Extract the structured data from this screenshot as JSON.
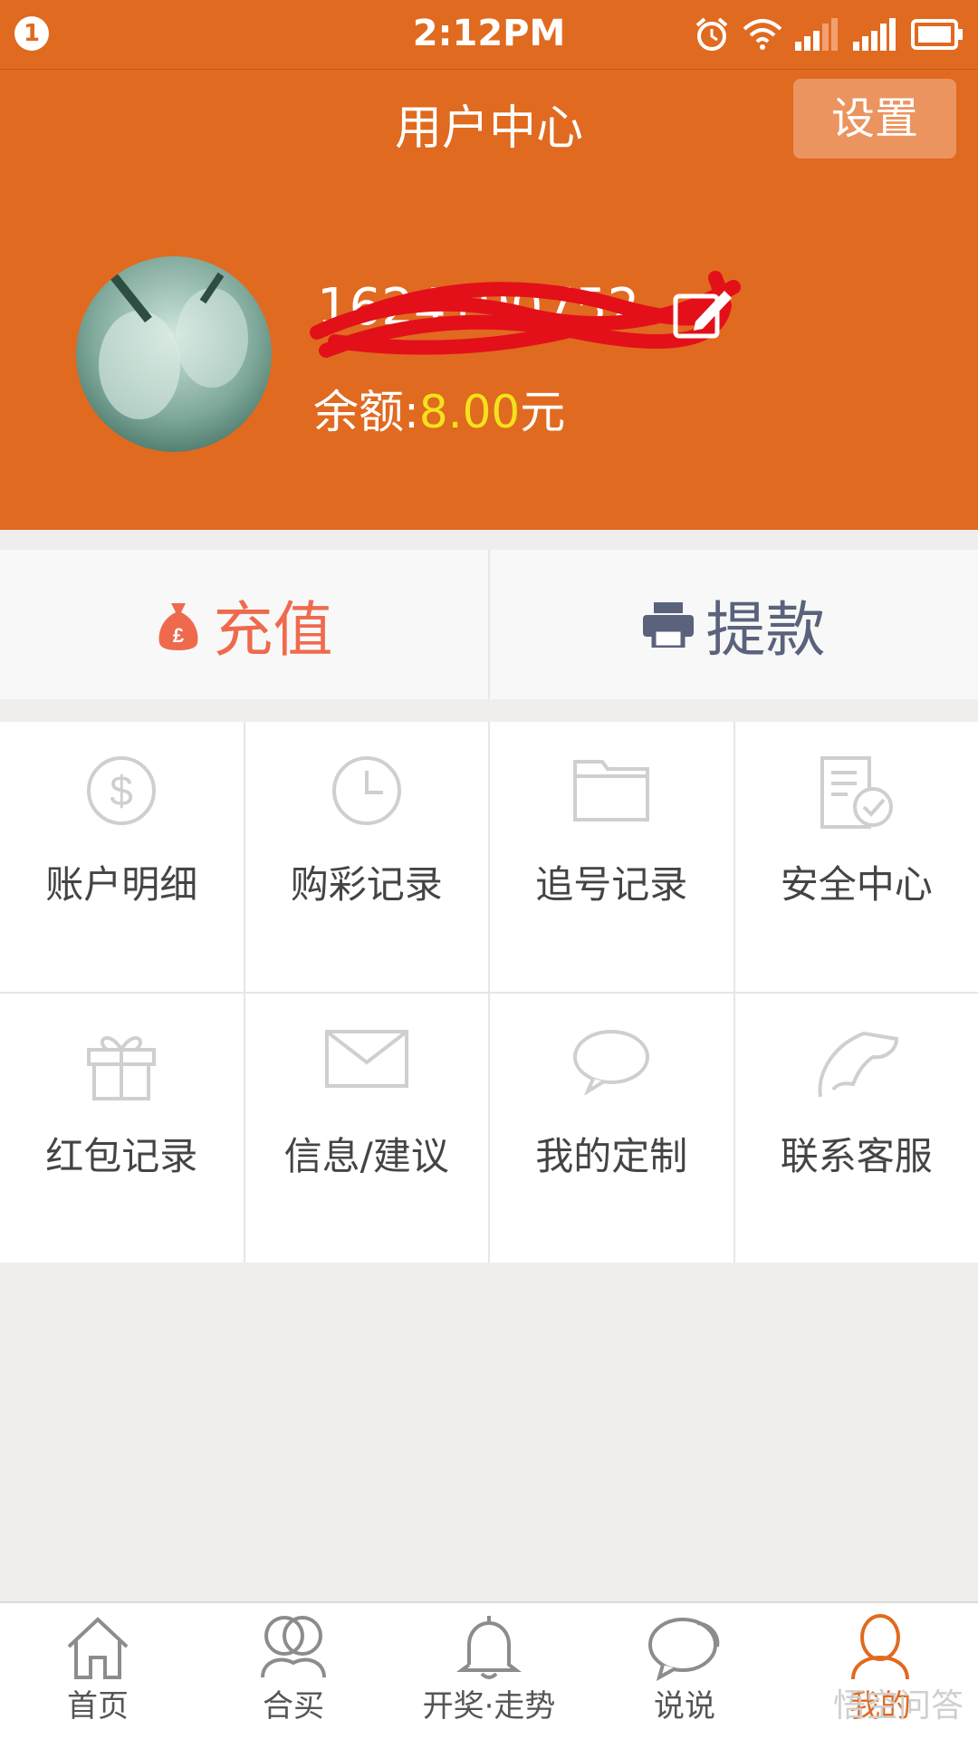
{
  "status": {
    "notification_count": "1",
    "time": "2:12PM"
  },
  "header": {
    "title": "用户中心",
    "settings_label": "设置"
  },
  "profile": {
    "username": "1624190752",
    "balance_label": "余额:",
    "balance_amount": "8.00",
    "balance_unit": "元"
  },
  "actions": {
    "recharge_label": "充值",
    "withdraw_label": "提款"
  },
  "menu": [
    {
      "label": "账户明细",
      "icon": "dollar-circle-icon"
    },
    {
      "label": "购彩记录",
      "icon": "clock-icon"
    },
    {
      "label": "追号记录",
      "icon": "folder-icon"
    },
    {
      "label": "安全中心",
      "icon": "document-check-icon"
    },
    {
      "label": "红包记录",
      "icon": "gift-icon"
    },
    {
      "label": "信息/建议",
      "icon": "mail-icon"
    },
    {
      "label": "我的定制",
      "icon": "chat-bubble-icon"
    },
    {
      "label": "联系客服",
      "icon": "phone-icon"
    }
  ],
  "tabs": [
    {
      "label": "首页",
      "icon": "home-icon"
    },
    {
      "label": "合买",
      "icon": "group-icon"
    },
    {
      "label": "开奖·走势",
      "icon": "bell-icon"
    },
    {
      "label": "说说",
      "icon": "chat-icon"
    },
    {
      "label": "我的",
      "icon": "user-icon",
      "active": true
    }
  ],
  "watermark": "悟空问答",
  "colors": {
    "brand": "#e06a20",
    "balance_amount": "#f5e21a",
    "recharge": "#ef6a4d",
    "withdraw": "#5a627c"
  }
}
